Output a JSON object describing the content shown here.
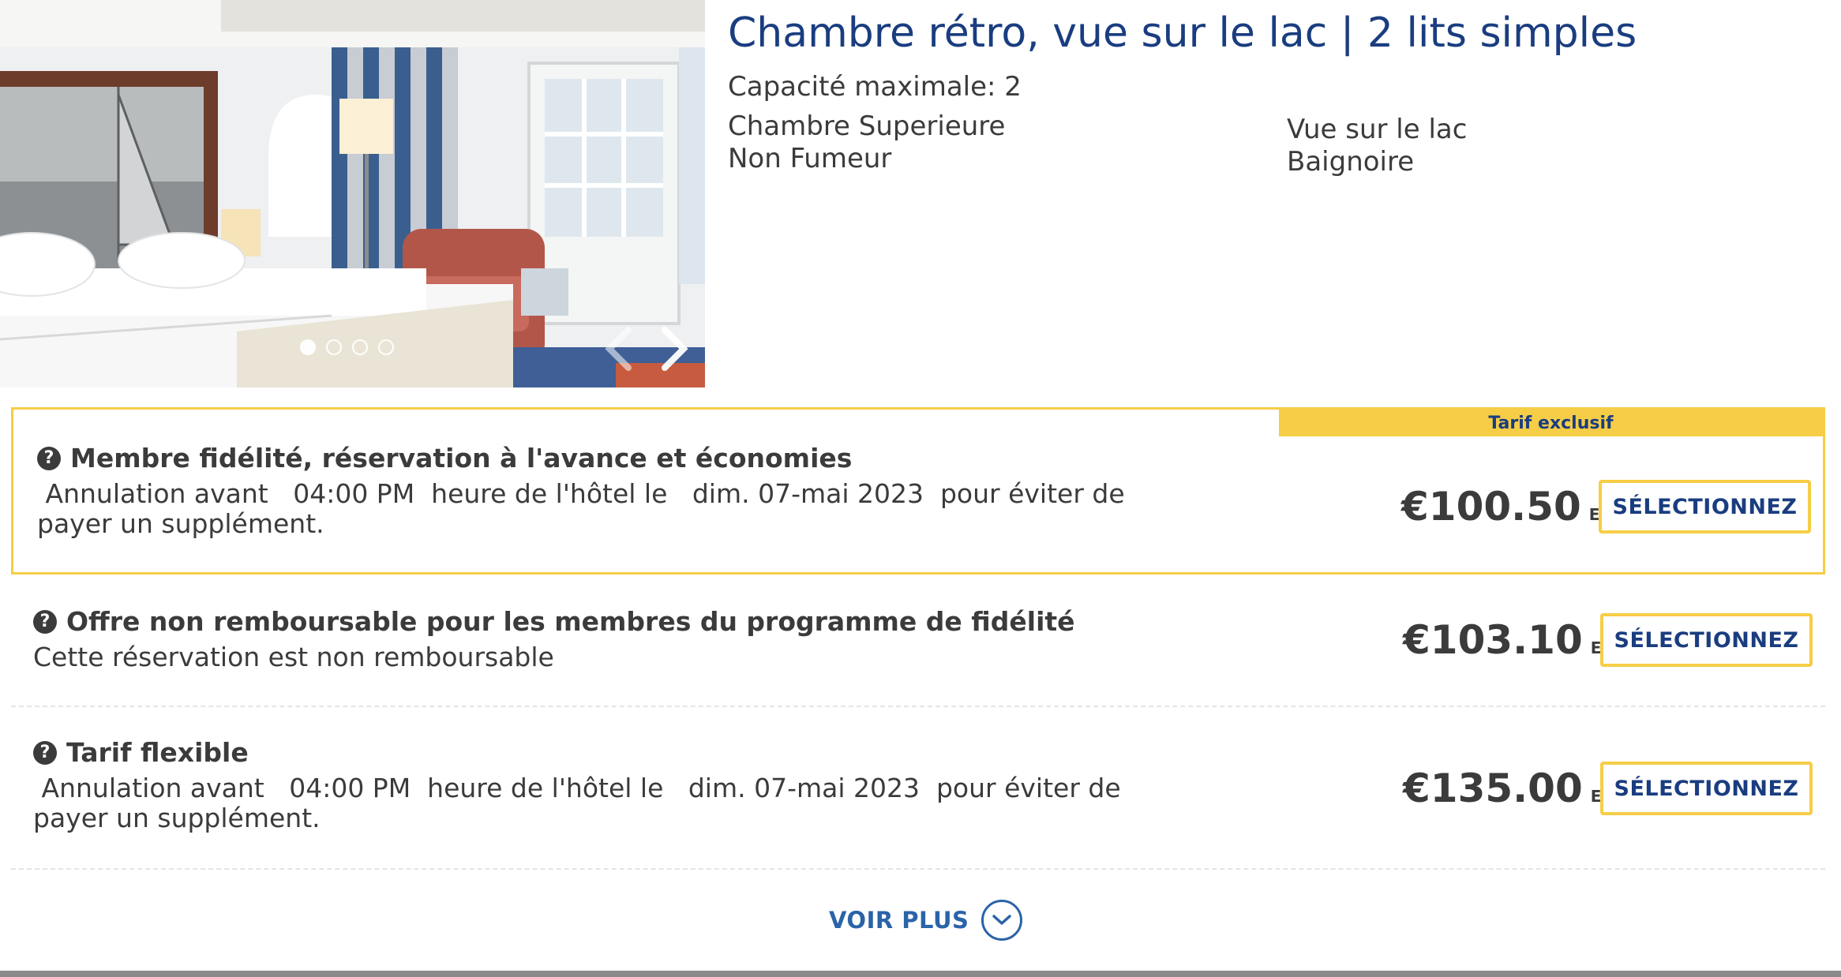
{
  "room": {
    "title": "Chambre rétro, vue sur le lac | 2 lits simples",
    "capacity": "Capacité maximale: 2",
    "features_left": [
      "Chambre Superieure",
      "Non Fumeur"
    ],
    "features_right": [
      "Vue sur le lac",
      "Baignoire"
    ],
    "gallery": {
      "image_alt": "Chambre avec deux lits simples, fauteuil rouge et porte-fenêtre",
      "current_slide": 1,
      "slide_count": 4,
      "prev_icon": "chevron-left-icon",
      "next_icon": "chevron-right-icon"
    }
  },
  "rates": [
    {
      "badge": "Tarif exclusif",
      "name": "Membre fidélité, réservation à l'avance et économies",
      "description": " Annulation avant   04:00 PM  heure de l'hôtel le   dim. 07-mai 2023  pour éviter de payer un supplément.",
      "price": "€100.50",
      "currency": "EUR",
      "button": "SÉLECTIONNEZ"
    },
    {
      "name": "Offre non remboursable pour les membres du programme de fidélité",
      "description": "Cette réservation est non remboursable",
      "price": "€103.10",
      "currency": "EUR",
      "button": "SÉLECTIONNEZ"
    },
    {
      "name": "Tarif flexible",
      "description": " Annulation avant   04:00 PM  heure de l'hôtel le   dim. 07-mai 2023  pour éviter de payer un supplément.",
      "price": "€135.00",
      "currency": "EUR",
      "button": "SÉLECTIONNEZ"
    }
  ],
  "help_icon": "?",
  "voir_plus": "VOIR PLUS",
  "colors": {
    "title_blue": "#1a3d80",
    "link_blue": "#2a63a8",
    "accent_yellow": "#f6cd46",
    "text": "#3b3b3b"
  }
}
